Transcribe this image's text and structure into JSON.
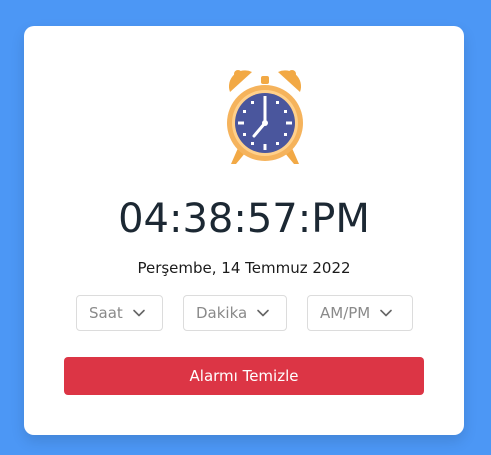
{
  "clock": {
    "time": "04:38:57:PM",
    "date": "Perşembe, 14 Temmuz 2022"
  },
  "icon": "alarm-clock-icon",
  "selects": {
    "hour": {
      "value": "Saat"
    },
    "minute": {
      "value": "Dakika"
    },
    "ampm": {
      "value": "AM/PM"
    }
  },
  "actions": {
    "clear_label": "Alarmı Temizle"
  },
  "colors": {
    "background": "#4c97f5",
    "card": "#ffffff",
    "button": "#dc3545",
    "clock_face": "#4a569d",
    "clock_frame": "#f5b35c"
  }
}
